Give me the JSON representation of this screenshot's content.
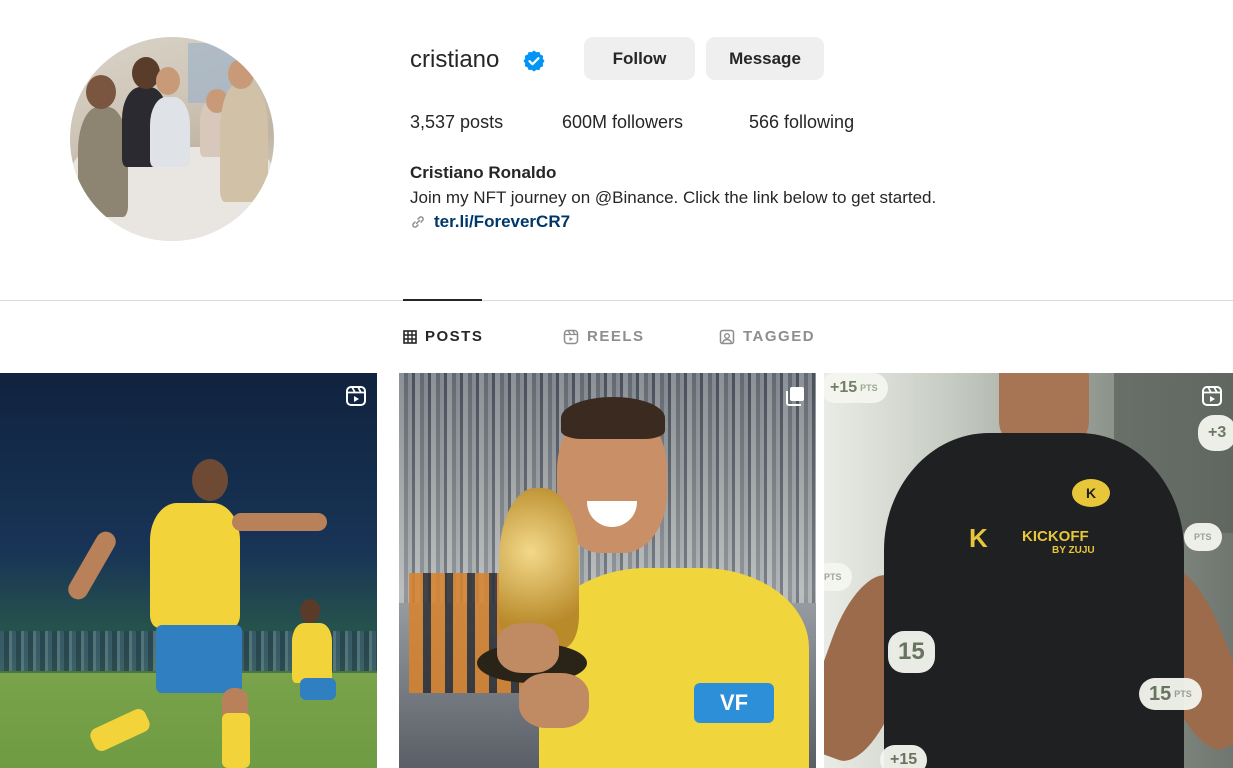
{
  "profile": {
    "username": "cristiano",
    "verified": true,
    "follow_label": "Follow",
    "message_label": "Message",
    "stats": {
      "posts": "3,537 posts",
      "followers": "600M followers",
      "following": "566 following"
    },
    "full_name": "Cristiano Ronaldo",
    "bio": "Join my NFT journey on @Binance. Click the link below to get started.",
    "link": "ter.li/ForeverCR7"
  },
  "tabs": [
    {
      "label": "POSTS",
      "icon": "grid-icon",
      "active": true
    },
    {
      "label": "REELS",
      "icon": "reels-icon",
      "active": false
    },
    {
      "label": "TAGGED",
      "icon": "tagged-icon",
      "active": false
    }
  ],
  "posts": [
    {
      "type": "reel",
      "icon": "reels-icon"
    },
    {
      "type": "carousel",
      "icon": "carousel-icon",
      "armband_text": "VF"
    },
    {
      "type": "reel",
      "icon": "reels-icon",
      "logo_text": "KICKOFF",
      "logo_sub": "BY ZUJU",
      "pills": [
        "+15",
        "+3",
        "PTS",
        "PTS",
        "15",
        "15",
        "+15"
      ],
      "pill_unit": "PTS"
    }
  ],
  "colors": {
    "verified_blue": "#0095f6",
    "link": "#00376b",
    "button_bg": "#efefef"
  }
}
